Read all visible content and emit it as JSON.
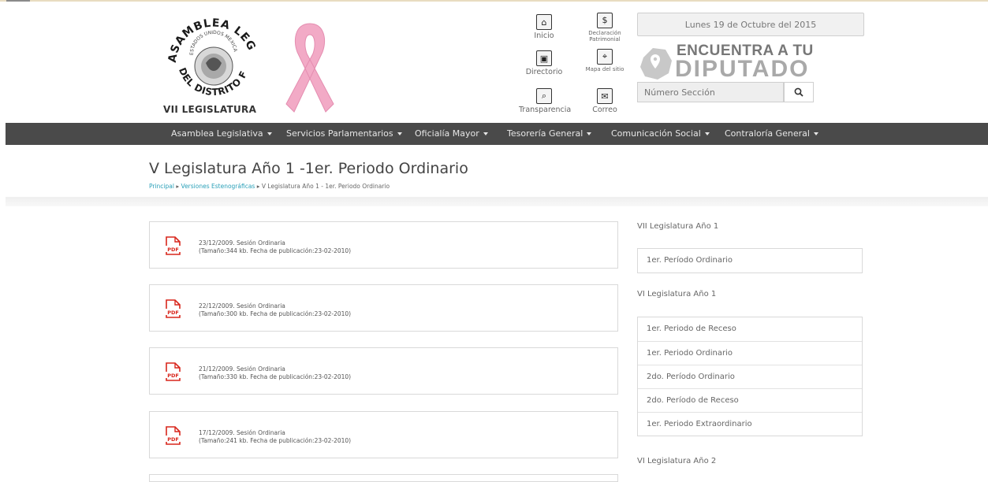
{
  "header": {
    "logo_arc_text": "ASAMBLEA LEGISLATIVA",
    "logo_inner_text": "ESTADOS UNIDOS MEXICANOS",
    "logo_bottom_text": "DEL DISTRITO FEDERAL",
    "logo_caption": "VII LEGISLATURA",
    "quick_links": [
      {
        "label": "Inicio",
        "icon": "home-icon"
      },
      {
        "label": "Declaración Patrimonial",
        "icon": "dollar-icon"
      },
      {
        "label": "Directorio",
        "icon": "contact-card-icon"
      },
      {
        "label": "Mapa del sitio",
        "icon": "map-icon"
      },
      {
        "label": "Transparencia",
        "icon": "magnifier-doc-icon"
      },
      {
        "label": "Correo",
        "icon": "envelope-icon"
      }
    ],
    "date": "Lunes 19 de Octubre del 2015",
    "finder_line1": "ENCUENTRA A TU",
    "finder_line2": "DIPUTADO",
    "search_placeholder": "Número Sección"
  },
  "nav": {
    "items": [
      "Asamblea Legislativa",
      "Servicios Parlamentarios",
      "Oficialía Mayor",
      "Tesorería General",
      "Comunicación Social",
      "Contraloría General"
    ]
  },
  "page": {
    "title": "V Legislatura Año 1 -1er. Periodo Ordinario",
    "breadcrumb": [
      "Principal",
      "Versiones Estenográficas",
      "V Legislatura Año 1 - 1er. Periodo Ordinario"
    ],
    "breadcrumb_sep": "▸"
  },
  "documents": [
    {
      "title": "23/12/2009. Sesión Ordinaria",
      "meta": "(Tamaño:344 kb. Fecha de publicación:23-02-2010)",
      "icon_label": "PDF"
    },
    {
      "title": "22/12/2009. Sesión Ordinaria",
      "meta": "(Tamaño:300 kb. Fecha de publicación:23-02-2010)",
      "icon_label": "PDF"
    },
    {
      "title": "21/12/2009. Sesión Ordinaria",
      "meta": "(Tamaño:330 kb. Fecha de publicación:23-02-2010)",
      "icon_label": "PDF"
    },
    {
      "title": "17/12/2009. Sesión Ordinaria",
      "meta": "(Tamaño:241 kb. Fecha de publicación:23-02-2010)",
      "icon_label": "PDF"
    }
  ],
  "sidebar": {
    "groups": [
      {
        "heading": "VII Legislatura Año 1",
        "items": [
          "1er. Período Ordinario"
        ]
      },
      {
        "heading": "VI Legislatura Año 1",
        "items": [
          "1er. Periodo de Receso",
          "1er. Periodo Ordinario",
          "2do. Período Ordinario",
          "2do. Período de Receso",
          "1er. Periodo Extraordinario"
        ]
      },
      {
        "heading": "VI Legislatura Año 2",
        "items": []
      }
    ]
  },
  "colors": {
    "nav_bg": "#4a4a4a",
    "link": "#2aa0b8",
    "pdf_red": "#d9261c",
    "ribbon_pink": "#f2aac6"
  }
}
